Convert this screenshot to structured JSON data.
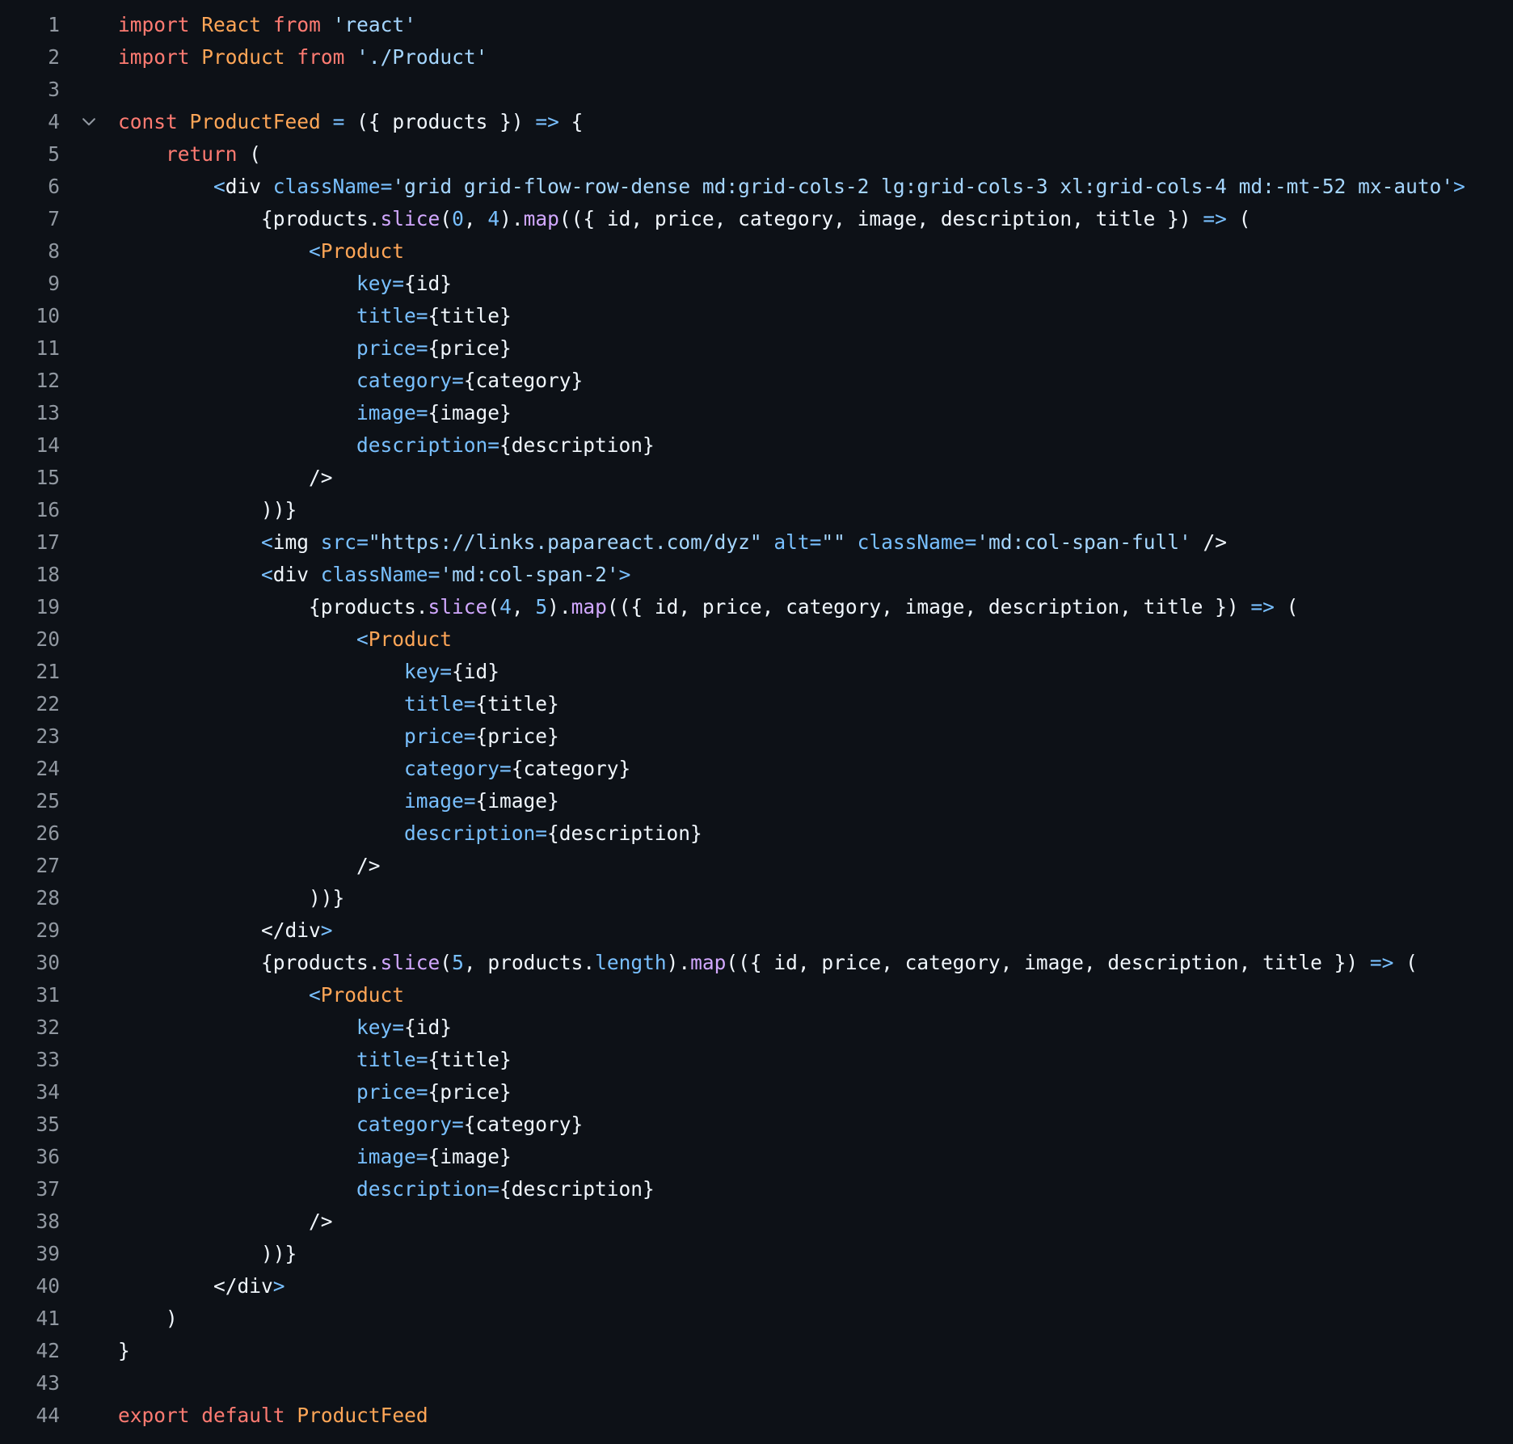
{
  "colors": {
    "background": "#0d1117",
    "line_number": "#9198a1",
    "text": "#f0f6fc",
    "keyword": "#ff7b72",
    "identifier": "#ffa657",
    "string": "#a5d6ff",
    "operator": "#79c0ff",
    "function": "#d2a8ff"
  },
  "fold_icon": "chevron-down-icon",
  "lines": [
    {
      "n": "1",
      "indent": 0,
      "tokens": [
        [
          "kw",
          "import"
        ],
        [
          "txt",
          " "
        ],
        [
          "id",
          "React"
        ],
        [
          "txt",
          " "
        ],
        [
          "kw",
          "from"
        ],
        [
          "txt",
          " "
        ],
        [
          "str",
          "'react'"
        ]
      ]
    },
    {
      "n": "2",
      "indent": 0,
      "tokens": [
        [
          "kw",
          "import"
        ],
        [
          "txt",
          " "
        ],
        [
          "id",
          "Product"
        ],
        [
          "txt",
          " "
        ],
        [
          "kw",
          "from"
        ],
        [
          "txt",
          " "
        ],
        [
          "str",
          "'./Product'"
        ]
      ]
    },
    {
      "n": "3",
      "indent": 0,
      "tokens": []
    },
    {
      "n": "4",
      "indent": 0,
      "fold": true,
      "tokens": [
        [
          "kw",
          "const"
        ],
        [
          "txt",
          " "
        ],
        [
          "id",
          "ProductFeed"
        ],
        [
          "txt",
          " "
        ],
        [
          "op",
          "="
        ],
        [
          "txt",
          " ({ products }) "
        ],
        [
          "op",
          "=>"
        ],
        [
          "txt",
          " {"
        ]
      ]
    },
    {
      "n": "5",
      "indent": 1,
      "tokens": [
        [
          "kw",
          "return"
        ],
        [
          "txt",
          " ("
        ]
      ]
    },
    {
      "n": "6",
      "indent": 2,
      "tokens": [
        [
          "op",
          "<"
        ],
        [
          "txt",
          "div "
        ],
        [
          "attr",
          "className"
        ],
        [
          "op",
          "="
        ],
        [
          "str",
          "'grid grid-flow-row-dense md:grid-cols-2 lg:grid-cols-3 xl:grid-cols-4 md:-mt-52 mx-auto'"
        ],
        [
          "op",
          ">"
        ]
      ]
    },
    {
      "n": "7",
      "indent": 3,
      "tokens": [
        [
          "txt",
          "{products."
        ],
        [
          "fn",
          "slice"
        ],
        [
          "txt",
          "("
        ],
        [
          "num",
          "0"
        ],
        [
          "txt",
          ", "
        ],
        [
          "num",
          "4"
        ],
        [
          "txt",
          ")."
        ],
        [
          "fn",
          "map"
        ],
        [
          "txt",
          "(({ id, price, category, image, description, title }) "
        ],
        [
          "op",
          "=>"
        ],
        [
          "txt",
          " ("
        ]
      ]
    },
    {
      "n": "8",
      "indent": 4,
      "tokens": [
        [
          "op",
          "<"
        ],
        [
          "id",
          "Product"
        ]
      ]
    },
    {
      "n": "9",
      "indent": 5,
      "tokens": [
        [
          "attr",
          "key"
        ],
        [
          "op",
          "="
        ],
        [
          "txt",
          "{id}"
        ]
      ]
    },
    {
      "n": "10",
      "indent": 5,
      "tokens": [
        [
          "attr",
          "title"
        ],
        [
          "op",
          "="
        ],
        [
          "txt",
          "{title}"
        ]
      ]
    },
    {
      "n": "11",
      "indent": 5,
      "tokens": [
        [
          "attr",
          "price"
        ],
        [
          "op",
          "="
        ],
        [
          "txt",
          "{price}"
        ]
      ]
    },
    {
      "n": "12",
      "indent": 5,
      "tokens": [
        [
          "attr",
          "category"
        ],
        [
          "op",
          "="
        ],
        [
          "txt",
          "{category}"
        ]
      ]
    },
    {
      "n": "13",
      "indent": 5,
      "tokens": [
        [
          "attr",
          "image"
        ],
        [
          "op",
          "="
        ],
        [
          "txt",
          "{image}"
        ]
      ]
    },
    {
      "n": "14",
      "indent": 5,
      "tokens": [
        [
          "attr",
          "description"
        ],
        [
          "op",
          "="
        ],
        [
          "txt",
          "{description}"
        ]
      ]
    },
    {
      "n": "15",
      "indent": 4,
      "tokens": [
        [
          "txt",
          "/>"
        ]
      ]
    },
    {
      "n": "16",
      "indent": 3,
      "tokens": [
        [
          "txt",
          "))}"
        ]
      ]
    },
    {
      "n": "17",
      "indent": 3,
      "tokens": [
        [
          "op",
          "<"
        ],
        [
          "txt",
          "img "
        ],
        [
          "attr",
          "src"
        ],
        [
          "op",
          "="
        ],
        [
          "str",
          "\"https://links.papareact.com/dyz\""
        ],
        [
          "txt",
          " "
        ],
        [
          "attr",
          "alt"
        ],
        [
          "op",
          "="
        ],
        [
          "str",
          "\"\""
        ],
        [
          "txt",
          " "
        ],
        [
          "attr",
          "className"
        ],
        [
          "op",
          "="
        ],
        [
          "str",
          "'md:col-span-full'"
        ],
        [
          "txt",
          " />"
        ]
      ]
    },
    {
      "n": "18",
      "indent": 3,
      "tokens": [
        [
          "op",
          "<"
        ],
        [
          "txt",
          "div "
        ],
        [
          "attr",
          "className"
        ],
        [
          "op",
          "="
        ],
        [
          "str",
          "'md:col-span-2'"
        ],
        [
          "op",
          ">"
        ]
      ]
    },
    {
      "n": "19",
      "indent": 4,
      "tokens": [
        [
          "txt",
          "{products."
        ],
        [
          "fn",
          "slice"
        ],
        [
          "txt",
          "("
        ],
        [
          "num",
          "4"
        ],
        [
          "txt",
          ", "
        ],
        [
          "num",
          "5"
        ],
        [
          "txt",
          ")."
        ],
        [
          "fn",
          "map"
        ],
        [
          "txt",
          "(({ id, price, category, image, description, title }) "
        ],
        [
          "op",
          "=>"
        ],
        [
          "txt",
          " ("
        ]
      ]
    },
    {
      "n": "20",
      "indent": 5,
      "tokens": [
        [
          "op",
          "<"
        ],
        [
          "id",
          "Product"
        ]
      ]
    },
    {
      "n": "21",
      "indent": 6,
      "tokens": [
        [
          "attr",
          "key"
        ],
        [
          "op",
          "="
        ],
        [
          "txt",
          "{id}"
        ]
      ]
    },
    {
      "n": "22",
      "indent": 6,
      "tokens": [
        [
          "attr",
          "title"
        ],
        [
          "op",
          "="
        ],
        [
          "txt",
          "{title}"
        ]
      ]
    },
    {
      "n": "23",
      "indent": 6,
      "tokens": [
        [
          "attr",
          "price"
        ],
        [
          "op",
          "="
        ],
        [
          "txt",
          "{price}"
        ]
      ]
    },
    {
      "n": "24",
      "indent": 6,
      "tokens": [
        [
          "attr",
          "category"
        ],
        [
          "op",
          "="
        ],
        [
          "txt",
          "{category}"
        ]
      ]
    },
    {
      "n": "25",
      "indent": 6,
      "tokens": [
        [
          "attr",
          "image"
        ],
        [
          "op",
          "="
        ],
        [
          "txt",
          "{image}"
        ]
      ]
    },
    {
      "n": "26",
      "indent": 6,
      "tokens": [
        [
          "attr",
          "description"
        ],
        [
          "op",
          "="
        ],
        [
          "txt",
          "{description}"
        ]
      ]
    },
    {
      "n": "27",
      "indent": 5,
      "tokens": [
        [
          "txt",
          "/>"
        ]
      ]
    },
    {
      "n": "28",
      "indent": 4,
      "tokens": [
        [
          "txt",
          "))}"
        ]
      ]
    },
    {
      "n": "29",
      "indent": 3,
      "tokens": [
        [
          "txt",
          "</div"
        ],
        [
          "op",
          ">"
        ]
      ]
    },
    {
      "n": "30",
      "indent": 3,
      "tokens": [
        [
          "txt",
          "{products."
        ],
        [
          "fn",
          "slice"
        ],
        [
          "txt",
          "("
        ],
        [
          "num",
          "5"
        ],
        [
          "txt",
          ", products."
        ],
        [
          "op",
          "length"
        ],
        [
          "txt",
          ")."
        ],
        [
          "fn",
          "map"
        ],
        [
          "txt",
          "(({ id, price, category, image, description, title }) "
        ],
        [
          "op",
          "=>"
        ],
        [
          "txt",
          " ("
        ]
      ]
    },
    {
      "n": "31",
      "indent": 4,
      "tokens": [
        [
          "op",
          "<"
        ],
        [
          "id",
          "Product"
        ]
      ]
    },
    {
      "n": "32",
      "indent": 5,
      "tokens": [
        [
          "attr",
          "key"
        ],
        [
          "op",
          "="
        ],
        [
          "txt",
          "{id}"
        ]
      ]
    },
    {
      "n": "33",
      "indent": 5,
      "tokens": [
        [
          "attr",
          "title"
        ],
        [
          "op",
          "="
        ],
        [
          "txt",
          "{title}"
        ]
      ]
    },
    {
      "n": "34",
      "indent": 5,
      "tokens": [
        [
          "attr",
          "price"
        ],
        [
          "op",
          "="
        ],
        [
          "txt",
          "{price}"
        ]
      ]
    },
    {
      "n": "35",
      "indent": 5,
      "tokens": [
        [
          "attr",
          "category"
        ],
        [
          "op",
          "="
        ],
        [
          "txt",
          "{category}"
        ]
      ]
    },
    {
      "n": "36",
      "indent": 5,
      "tokens": [
        [
          "attr",
          "image"
        ],
        [
          "op",
          "="
        ],
        [
          "txt",
          "{image}"
        ]
      ]
    },
    {
      "n": "37",
      "indent": 5,
      "tokens": [
        [
          "attr",
          "description"
        ],
        [
          "op",
          "="
        ],
        [
          "txt",
          "{description}"
        ]
      ]
    },
    {
      "n": "38",
      "indent": 4,
      "tokens": [
        [
          "txt",
          "/>"
        ]
      ]
    },
    {
      "n": "39",
      "indent": 3,
      "tokens": [
        [
          "txt",
          "))}"
        ]
      ]
    },
    {
      "n": "40",
      "indent": 2,
      "tokens": [
        [
          "txt",
          "</div"
        ],
        [
          "op",
          ">"
        ]
      ]
    },
    {
      "n": "41",
      "indent": 1,
      "tokens": [
        [
          "txt",
          ")"
        ]
      ]
    },
    {
      "n": "42",
      "indent": 0,
      "tokens": [
        [
          "txt",
          "}"
        ]
      ]
    },
    {
      "n": "43",
      "indent": 0,
      "tokens": []
    },
    {
      "n": "44",
      "indent": 0,
      "tokens": [
        [
          "kw",
          "export"
        ],
        [
          "txt",
          " "
        ],
        [
          "kw",
          "default"
        ],
        [
          "txt",
          " "
        ],
        [
          "id",
          "ProductFeed"
        ]
      ]
    }
  ]
}
